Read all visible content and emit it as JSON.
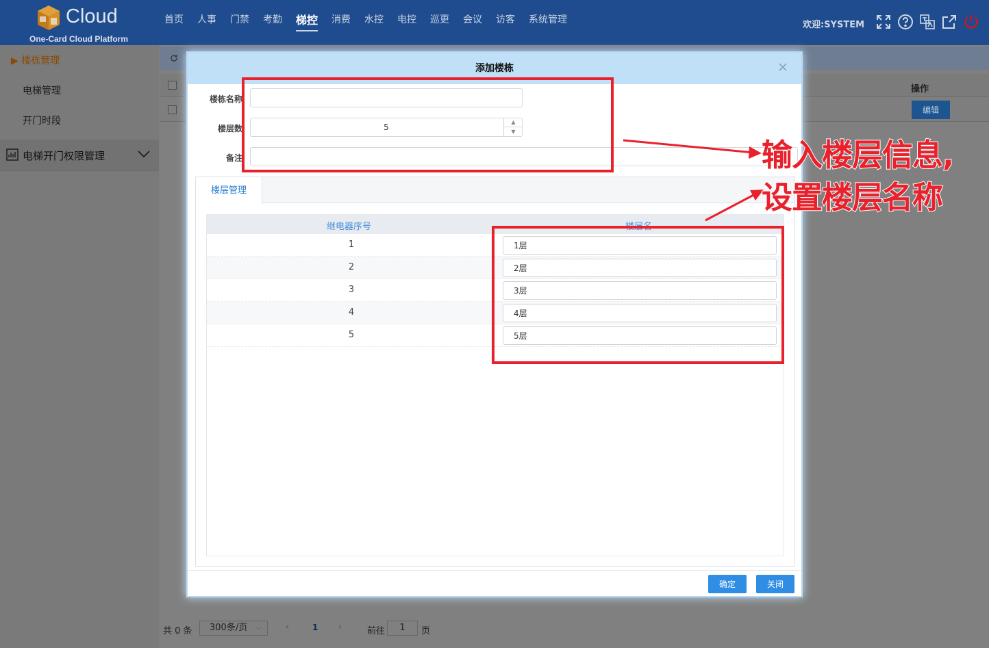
{
  "header": {
    "logo_text": "Cloud",
    "logo_sub": "One-Card Cloud Platform",
    "nav": [
      {
        "label": "首页",
        "active": false
      },
      {
        "label": "人事",
        "active": false
      },
      {
        "label": "门禁",
        "active": false
      },
      {
        "label": "考勤",
        "active": false
      },
      {
        "label": "梯控",
        "active": true
      },
      {
        "label": "消费",
        "active": false
      },
      {
        "label": "水控",
        "active": false
      },
      {
        "label": "电控",
        "active": false
      },
      {
        "label": "巡更",
        "active": false
      },
      {
        "label": "会议",
        "active": false
      },
      {
        "label": "访客",
        "active": false
      },
      {
        "label": "系统管理",
        "active": false
      }
    ],
    "welcome": "欢迎:SYSTEM",
    "icons": [
      "fullscreen-icon",
      "help-icon",
      "language-icon",
      "external-link-icon",
      "power-icon"
    ]
  },
  "sidebar": {
    "items": [
      {
        "label": "▶ 楼栋管理",
        "active": true
      },
      {
        "label": "电梯管理",
        "active": false
      },
      {
        "label": "开门时段",
        "active": false
      }
    ],
    "group": {
      "label": "电梯开门权限管理"
    }
  },
  "background": {
    "op_header": "操作",
    "edit_label": "编辑",
    "pager": {
      "total": "共 0 条",
      "page_size": "300条/页",
      "current_page": "1",
      "goto_label": "前往",
      "goto_value": "1",
      "page_unit": "页"
    }
  },
  "modal": {
    "title": "添加楼栋",
    "fields": {
      "name_label": "楼栋名称",
      "name_value": "",
      "floors_label": "楼层数",
      "floors_value": "5",
      "remark_label": "备注",
      "remark_value": ""
    },
    "tab": "楼层管理",
    "table": {
      "col_seq": "继电器序号",
      "col_name": "楼层名",
      "rows": [
        {
          "seq": "1",
          "name": "1层"
        },
        {
          "seq": "2",
          "name": "2层"
        },
        {
          "seq": "3",
          "name": "3层"
        },
        {
          "seq": "4",
          "name": "4层"
        },
        {
          "seq": "5",
          "name": "5层"
        }
      ]
    },
    "confirm": "确定",
    "close": "关闭"
  },
  "annotation": {
    "line1": "输入楼层信息,",
    "line2": "设置楼层名称",
    "color": "#e8212c"
  }
}
